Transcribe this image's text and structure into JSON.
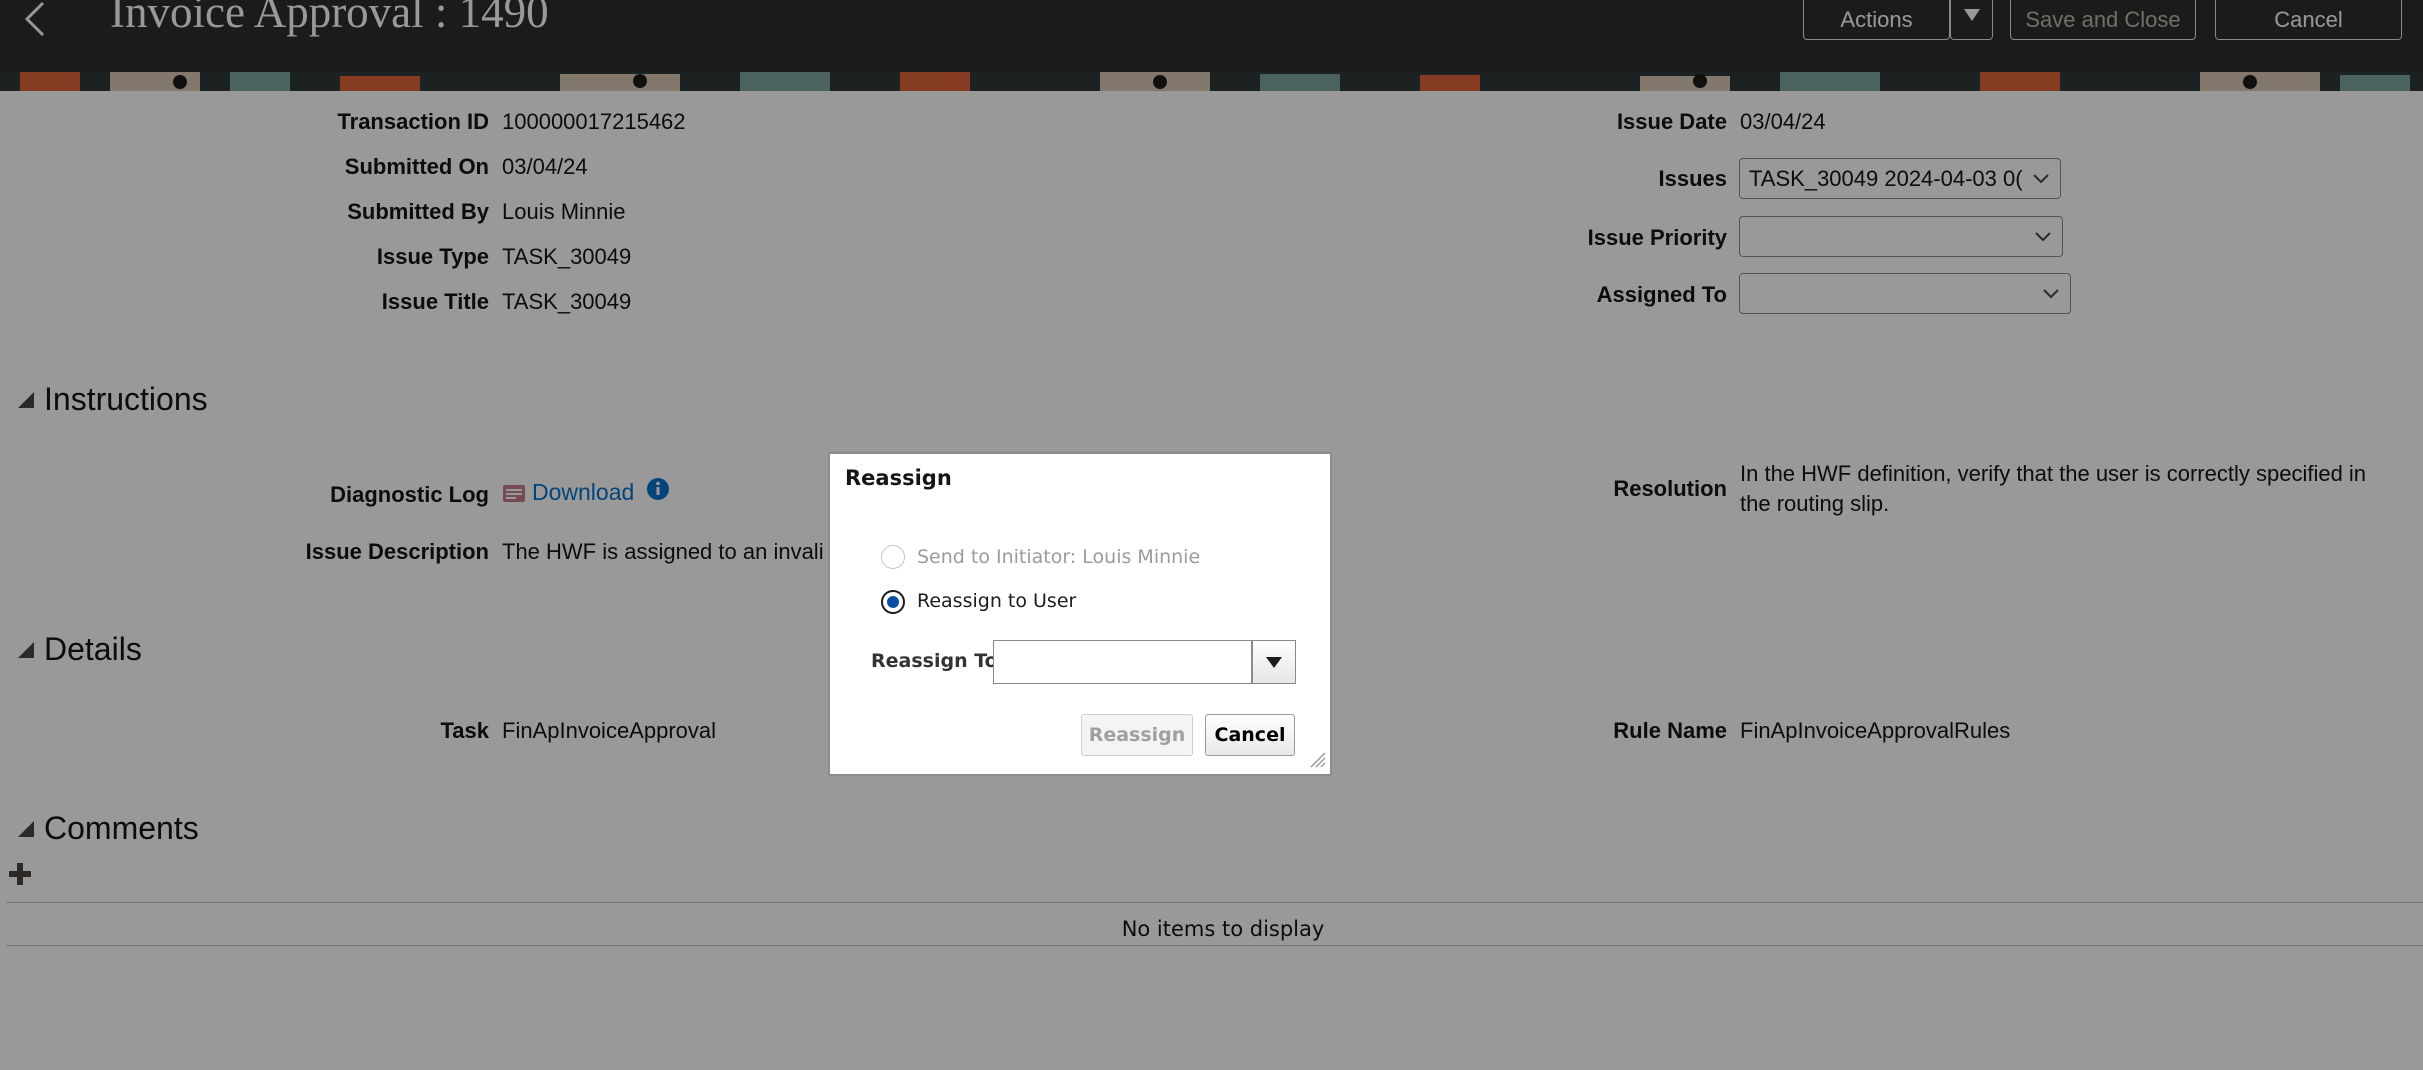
{
  "header": {
    "title": "Invoice Approval : 1490",
    "actions_label": "Actions",
    "save_close_label": "Save and Close",
    "cancel_label": "Cancel"
  },
  "fields": {
    "transaction_id": {
      "label": "Transaction ID",
      "value": "100000017215462"
    },
    "submitted_on": {
      "label": "Submitted On",
      "value": "03/04/24"
    },
    "submitted_by": {
      "label": "Submitted By",
      "value": "Louis Minnie"
    },
    "issue_type": {
      "label": "Issue Type",
      "value": "TASK_30049"
    },
    "issue_title": {
      "label": "Issue Title",
      "value": "TASK_30049"
    },
    "issue_date": {
      "label": "Issue Date",
      "value": "03/04/24"
    },
    "issues": {
      "label": "Issues",
      "value": "TASK_30049 2024-04-03 0("
    },
    "issue_priority": {
      "label": "Issue Priority",
      "value": ""
    },
    "assigned_to": {
      "label": "Assigned To",
      "value": ""
    }
  },
  "instructions": {
    "heading": "Instructions",
    "diagnostic_log_label": "Diagnostic Log",
    "download_label": "Download",
    "issue_description_label": "Issue Description",
    "issue_description_value": "The HWF is assigned to an invali",
    "resolution_label": "Resolution",
    "resolution_line1": "In the HWF definition, verify that the user is correctly specified in",
    "resolution_line2": "the routing slip."
  },
  "details": {
    "heading": "Details",
    "task_label": "Task",
    "task_value": "FinApInvoiceApproval",
    "rule_name_label": "Rule Name",
    "rule_name_value": "FinApInvoiceApprovalRules"
  },
  "comments": {
    "heading": "Comments",
    "empty_text": "No items to display"
  },
  "dialog": {
    "title": "Reassign",
    "option_initiator": "Send to Initiator: Louis Minnie",
    "option_user": "Reassign to User",
    "selected_option": "Reassign to User",
    "reassign_to_label": "Reassign To",
    "reassign_to_value": "",
    "reassign_button": "Reassign",
    "cancel_button": "Cancel"
  },
  "colors": {
    "header_bg": "#312d2a",
    "link": "#0572ce",
    "overlay": "rgba(0,0,0,0.40)"
  }
}
